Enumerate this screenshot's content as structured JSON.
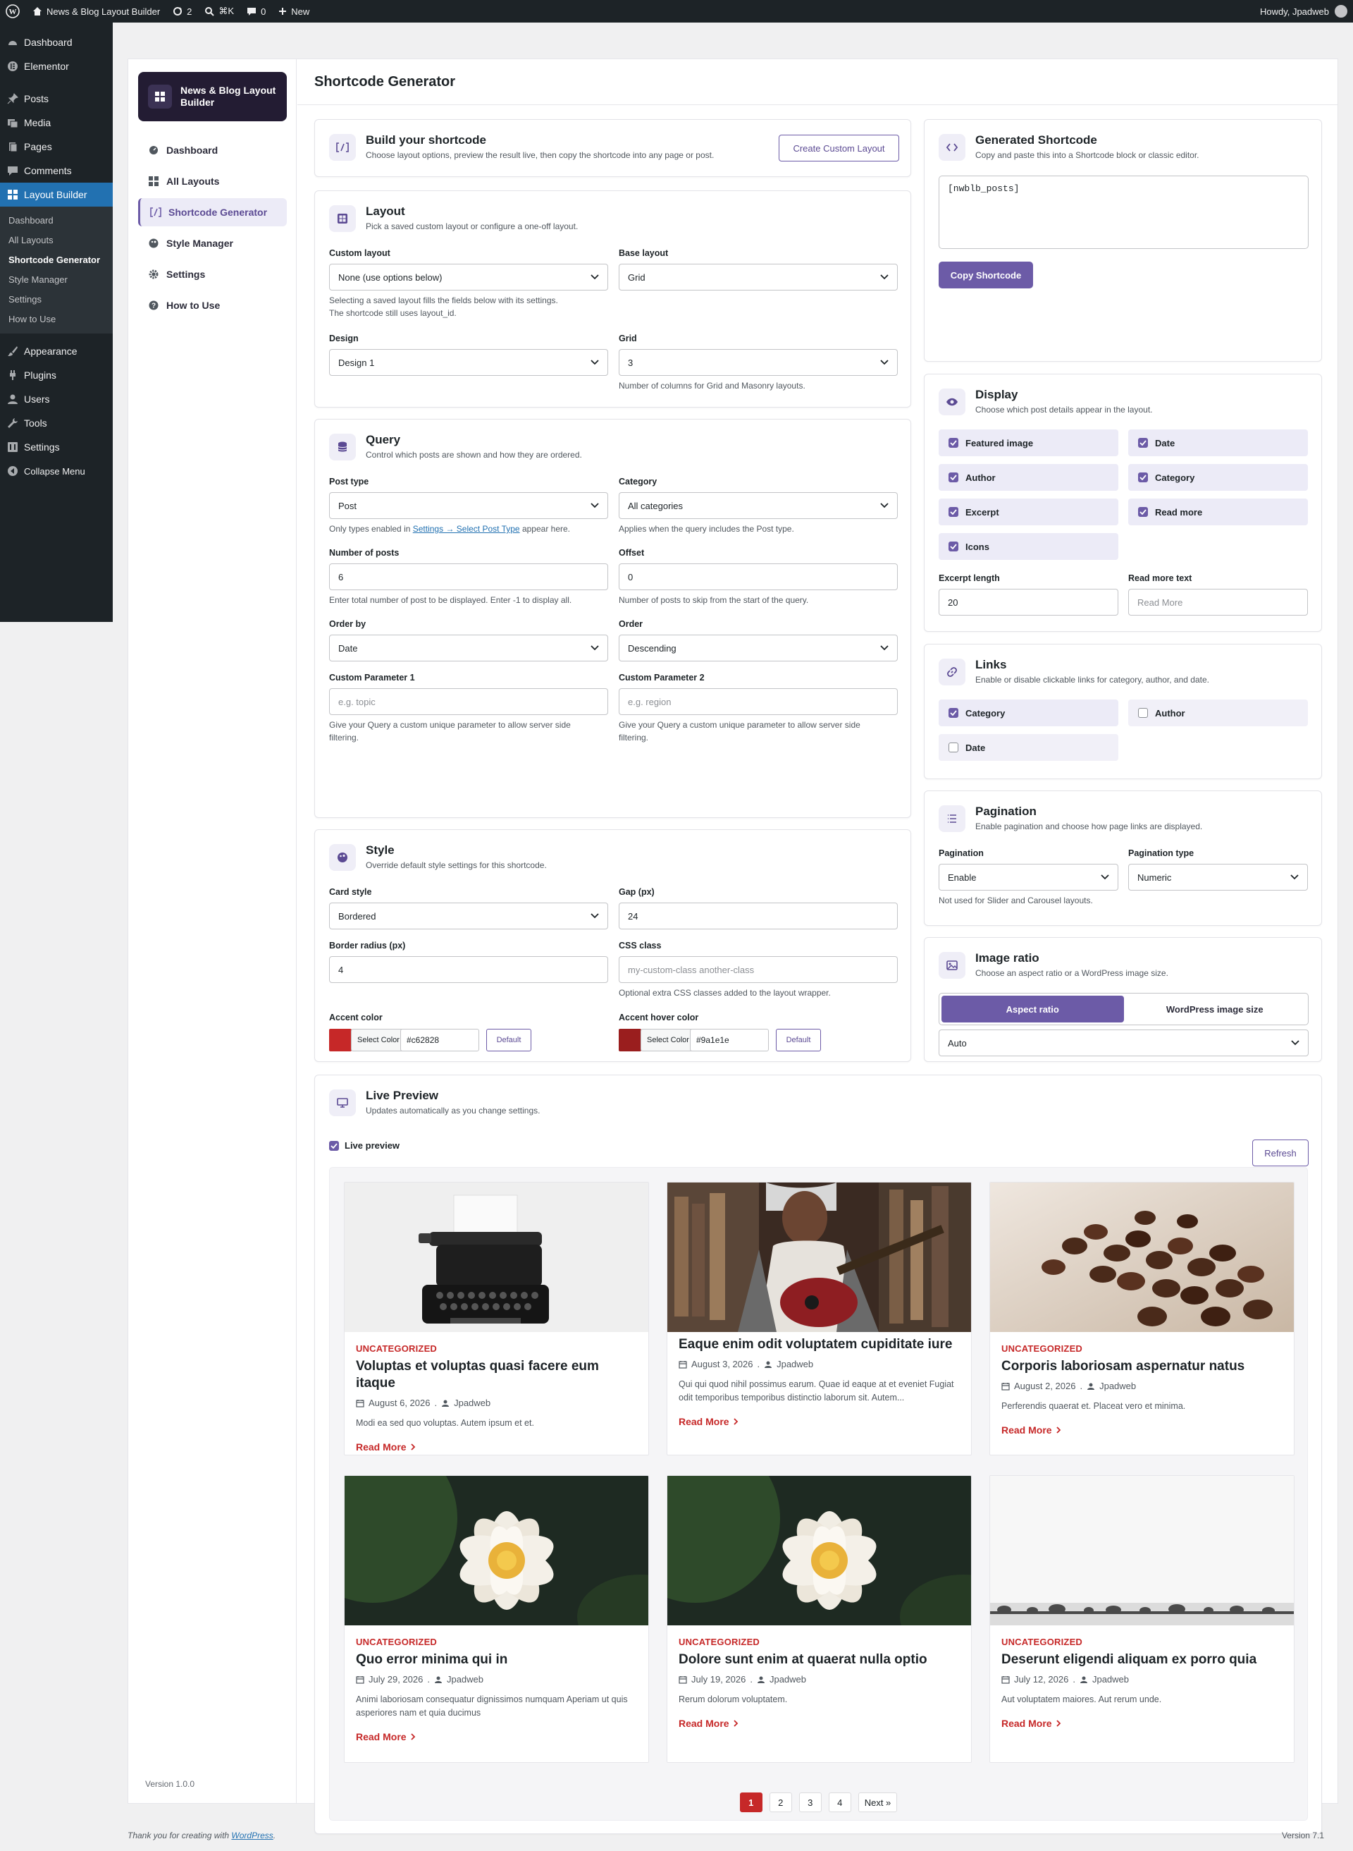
{
  "admin_bar": {
    "site_name": "News & Blog Layout Builder",
    "updates_count": "2",
    "shortcut": "⌘K",
    "comments_count": "0",
    "new_label": "New",
    "howdy": "Howdy, Jpadweb"
  },
  "admin_menu": {
    "items": [
      {
        "label": "Dashboard",
        "icon": "dashboard-icon"
      },
      {
        "label": "Elementor",
        "icon": "elementor-icon"
      },
      {
        "label": "Posts",
        "icon": "pin-icon"
      },
      {
        "label": "Media",
        "icon": "media-icon"
      },
      {
        "label": "Pages",
        "icon": "pages-icon"
      },
      {
        "label": "Comments",
        "icon": "comment-icon"
      },
      {
        "label": "Layout Builder",
        "icon": "grid-icon"
      }
    ],
    "sub_items": [
      "Dashboard",
      "All Layouts",
      "Shortcode Generator",
      "Style Manager",
      "Settings",
      "How to Use"
    ],
    "items_after": [
      {
        "label": "Appearance",
        "icon": "brush-icon"
      },
      {
        "label": "Plugins",
        "icon": "plug-icon"
      },
      {
        "label": "Users",
        "icon": "user-icon"
      },
      {
        "label": "Tools",
        "icon": "wrench-icon"
      },
      {
        "label": "Settings",
        "icon": "settings-icon"
      }
    ],
    "collapse": "Collapse Menu"
  },
  "plugin": {
    "brand": "News & Blog Layout Builder",
    "nav": [
      "Dashboard",
      "All Layouts",
      "Shortcode Generator",
      "Style Manager",
      "Settings",
      "How to Use"
    ],
    "version": "Version 1.0.0"
  },
  "page_title": "Shortcode Generator",
  "build": {
    "title": "Build your shortcode",
    "subtitle": "Choose layout options, preview the result live, then copy the shortcode into any page or post.",
    "button": "Create Custom Layout"
  },
  "layout": {
    "title": "Layout",
    "subtitle": "Pick a saved custom layout or configure a one-off layout.",
    "custom_layout_label": "Custom layout",
    "custom_layout_value": "None (use options below)",
    "custom_layout_help_1": "Selecting a saved layout fills the fields below with its settings.",
    "custom_layout_help_2": "The shortcode still uses layout_id.",
    "base_layout_label": "Base layout",
    "base_layout_value": "Grid",
    "design_label": "Design",
    "design_value": "Design 1",
    "grid_label": "Grid",
    "grid_value": "3",
    "grid_help": "Number of columns for Grid and Masonry layouts."
  },
  "query": {
    "title": "Query",
    "subtitle": "Control which posts are shown and how they are ordered.",
    "post_type_label": "Post type",
    "post_type_value": "Post",
    "post_type_help_pre": "Only types enabled in ",
    "post_type_help_link": "Settings → Select Post Type",
    "post_type_help_post": " appear here.",
    "category_label": "Category",
    "category_value": "All categories",
    "category_help": "Applies when the query includes the Post type.",
    "num_posts_label": "Number of posts",
    "num_posts_value": "6",
    "num_posts_help": "Enter total number of post to be displayed. Enter -1 to display all.",
    "offset_label": "Offset",
    "offset_value": "0",
    "offset_help": "Number of posts to skip from the start of the query.",
    "order_by_label": "Order by",
    "order_by_value": "Date",
    "order_label": "Order",
    "order_value": "Descending",
    "param1_label": "Custom Parameter 1",
    "param1_placeholder": "e.g. topic",
    "param2_label": "Custom Parameter 2",
    "param2_placeholder": "e.g. region",
    "param_help_1": "Give your Query a custom unique parameter to allow server side",
    "param_help_2": "filtering."
  },
  "style": {
    "title": "Style",
    "subtitle": "Override default style settings for this shortcode.",
    "card_style_label": "Card style",
    "card_style_value": "Bordered",
    "gap_label": "Gap (px)",
    "gap_value": "24",
    "radius_label": "Border radius (px)",
    "radius_value": "4",
    "css_label": "CSS class",
    "css_placeholder": "my-custom-class another-class",
    "css_help": "Optional extra CSS classes added to the layout wrapper.",
    "accent_label": "Accent color",
    "accent_value": "#c62828",
    "accent_hover_label": "Accent hover color",
    "accent_hover_value": "#9a1e1e",
    "select_color": "Select Color",
    "default_label": "Default"
  },
  "generated": {
    "title": "Generated Shortcode",
    "subtitle": "Copy and paste this into a Shortcode block or classic editor.",
    "code": "[nwblb_posts]",
    "copy_button": "Copy Shortcode"
  },
  "display": {
    "title": "Display",
    "subtitle": "Choose which post details appear in the layout.",
    "options": [
      {
        "label": "Featured image",
        "checked": true
      },
      {
        "label": "Date",
        "checked": true
      },
      {
        "label": "Author",
        "checked": true
      },
      {
        "label": "Category",
        "checked": true
      },
      {
        "label": "Excerpt",
        "checked": true
      },
      {
        "label": "Read more",
        "checked": true
      },
      {
        "label": "Icons",
        "checked": true
      }
    ],
    "excerpt_label": "Excerpt length",
    "excerpt_value": "20",
    "readmore_label": "Read more text",
    "readmore_placeholder": "Read More"
  },
  "links": {
    "title": "Links",
    "subtitle": "Enable or disable clickable links for category, author, and date.",
    "options": [
      {
        "label": "Category",
        "checked": true
      },
      {
        "label": "Author",
        "checked": false
      },
      {
        "label": "Date",
        "checked": false
      }
    ]
  },
  "pagination": {
    "title": "Pagination",
    "subtitle": "Enable pagination and choose how page links are displayed.",
    "pagination_label": "Pagination",
    "pagination_value": "Enable",
    "type_label": "Pagination type",
    "type_value": "Numeric",
    "help": "Not used for Slider and Carousel layouts."
  },
  "image_ratio": {
    "title": "Image ratio",
    "subtitle": "Choose an aspect ratio or a WordPress image size.",
    "tab_ratio": "Aspect ratio",
    "tab_size": "WordPress image size",
    "value": "Auto"
  },
  "preview": {
    "title": "Live Preview",
    "subtitle": "Updates automatically as you change settings.",
    "toggle": "Live preview",
    "refresh": "Refresh",
    "posts": [
      {
        "category": "UNCATEGORIZED",
        "title": "Voluptas et voluptas quasi facere eum itaque",
        "date": "August 6, 2026",
        "author": "Jpadweb",
        "excerpt": "Modi ea sed quo voluptas. Autem ipsum et et.",
        "read_more": "Read More",
        "image": "typewriter"
      },
      {
        "category": "",
        "title": "Eaque enim odit voluptatem cupiditate iure",
        "date": "August 3, 2026",
        "author": "Jpadweb",
        "excerpt": "Qui qui quod nihil possimus earum. Quae id eaque at et eveniet Fugiat odit temporibus temporibus distinctio laborum sit. Autem...",
        "read_more": "Read More",
        "image": "guitar"
      },
      {
        "category": "UNCATEGORIZED",
        "title": "Corporis laboriosam aspernatur natus",
        "date": "August 2, 2026",
        "author": "Jpadweb",
        "excerpt": "Perferendis quaerat et. Placeat vero et minima.",
        "read_more": "Read More",
        "image": "coffee"
      },
      {
        "category": "UNCATEGORIZED",
        "title": "Quo error minima qui in",
        "date": "July 29, 2026",
        "author": "Jpadweb",
        "excerpt": "Animi laboriosam consequatur dignissimos numquam Aperiam ut quis asperiores nam et quia ducimus",
        "read_more": "Read More",
        "image": "lotus"
      },
      {
        "category": "UNCATEGORIZED",
        "title": "Dolore sunt enim at quaerat nulla optio",
        "date": "July 19, 2026",
        "author": "Jpadweb",
        "excerpt": "Rerum dolorum voluptatem.",
        "read_more": "Read More",
        "image": "lotus"
      },
      {
        "category": "UNCATEGORIZED",
        "title": "Deserunt eligendi aliquam ex porro quia",
        "date": "July 12, 2026",
        "author": "Jpadweb",
        "excerpt": "Aut voluptatem maiores. Aut rerum unde.",
        "read_more": "Read More",
        "image": "landscape"
      }
    ],
    "pages": [
      "1",
      "2",
      "3",
      "4"
    ],
    "next": "Next »"
  },
  "footer": {
    "thanks_pre": "Thank you for creating with ",
    "thanks_link": "WordPress",
    "thanks_post": ".",
    "version": "Version 7.1"
  },
  "colors": {
    "accent": "#c62828",
    "accent_hover": "#9a1e1e",
    "brand": "#6c5ba7",
    "admin_blue": "#2271b1"
  }
}
